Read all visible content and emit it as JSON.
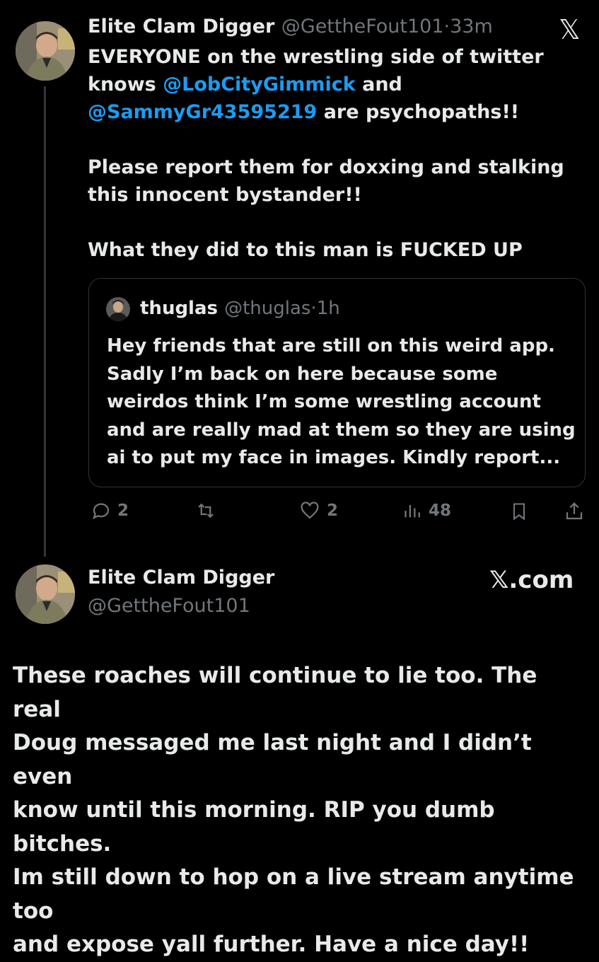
{
  "tweet": {
    "display_name": "Elite Clam Digger",
    "handle": "@GettheFout101",
    "separator": "·",
    "time": "33m",
    "text_line1": "EVERYONE on the wrestling side of twitter",
    "text_line2_prefix": "knows ",
    "mention1": "@LobCityGimmick",
    "text_line2_suffix": " and",
    "mention2": "@SammyGr43595219",
    "text_line3_suffix": " are psychopaths!!",
    "para2_line1": "Please report them for doxxing and stalking",
    "para2_line2": "this innocent bystander!!",
    "para3": "What they did to this man is FUCKED UP",
    "x_logo": "𝕏"
  },
  "quote": {
    "display_name": "thuglas",
    "handle": "@thuglas",
    "separator": "·",
    "time": "1h",
    "lines": [
      "Hey friends that are still on this weird app.",
      "Sadly I’m back on here because some",
      "weirdos think I’m some wrestling account",
      "and are really mad at them so they are using",
      "ai to put my face in images. Kindly report..."
    ]
  },
  "actions": {
    "replies": "2",
    "likes": "2",
    "views": "48"
  },
  "reply_card": {
    "display_name": "Elite Clam Digger",
    "handle": "@GettheFout101",
    "brand": "𝕏.com"
  },
  "caption": {
    "lines": [
      "These roaches will continue to lie too. The real",
      "Doug messaged me last night and I didn’t even",
      "know until this morning. RIP you dumb bitches.",
      "Im still down to hop on a live stream anytime too",
      "and expose yall further. Have a nice day!!"
    ]
  },
  "colors": {
    "background": "#000000",
    "text": "#e7e9ea",
    "muted": "#71767b",
    "mention": "#1d9bf0",
    "border": "#2f3336"
  },
  "icons": [
    "reply-icon",
    "retweet-icon",
    "like-icon",
    "views-icon",
    "bookmark-icon",
    "share-icon",
    "x-logo-icon"
  ]
}
